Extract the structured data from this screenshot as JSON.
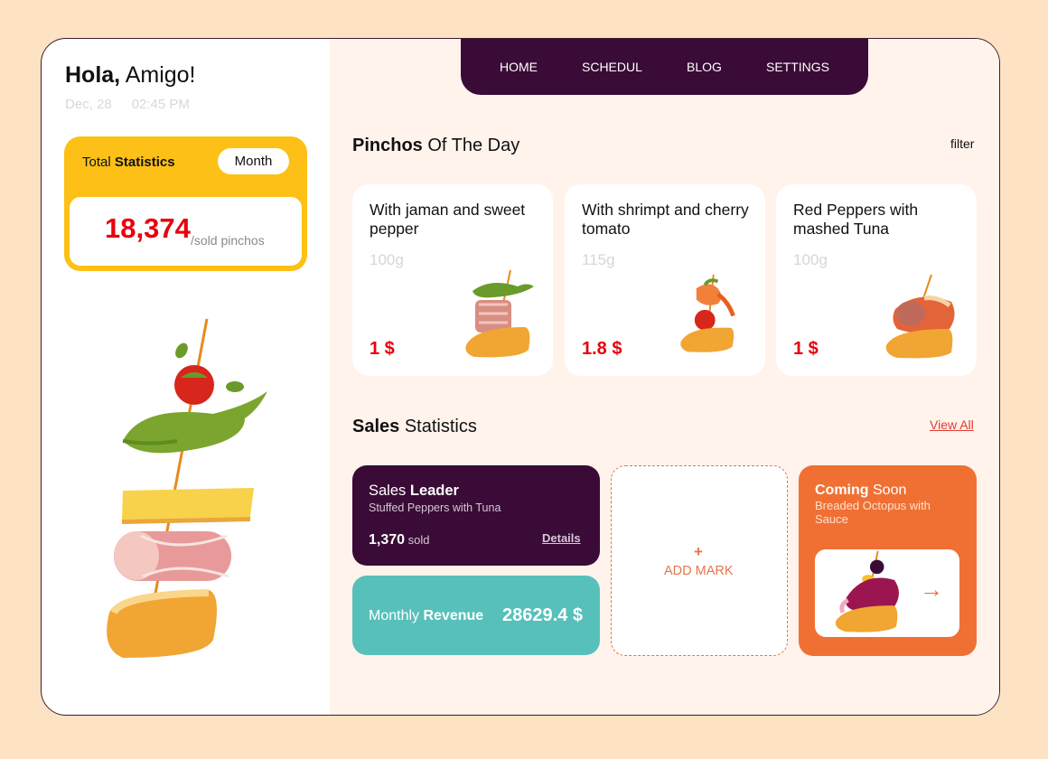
{
  "greeting": {
    "bold": "Hola,",
    "rest": " Amigo!"
  },
  "date": "Dec, 28",
  "time": "02:45 PM",
  "nav": [
    "HOME",
    "SCHEDUL",
    "BLOG",
    "SETTINGS"
  ],
  "total": {
    "label": "Total ",
    "label_bold": "Statistics",
    "period": "Month",
    "value": "18,374",
    "unit": "/sold pinchos"
  },
  "pinchos": {
    "title_bold": "Pinchos",
    "title_rest": " Of The Day",
    "filter": "filter",
    "items": [
      {
        "name": "With jaman and sweet pepper",
        "weight": "100g",
        "price": "1 $"
      },
      {
        "name": "With shrimpt and cherry tomato",
        "weight": "115g",
        "price": "1.8 $"
      },
      {
        "name": "Red Peppers with mashed Tuna",
        "weight": "100g",
        "price": "1 $"
      }
    ]
  },
  "sales": {
    "title_bold": "Sales",
    "title_rest": " Statistics",
    "view_all": "View All",
    "leader": {
      "label": "Sales ",
      "label_bold": "Leader",
      "item": "Stuffed Peppers with Tuna",
      "count": "1,370",
      "count_unit": " sold",
      "details": "Details"
    },
    "revenue": {
      "label": "Monthly ",
      "label_bold": "Revenue",
      "value": "28629.4 $"
    },
    "add_mark": {
      "icon": "plus-icon",
      "label": "ADD MARK"
    },
    "coming": {
      "label_bold": "Coming",
      "label": " Soon",
      "item": "Breaded Octopus with Sauce",
      "icon": "arrow-right-icon"
    }
  },
  "colors": {
    "background": "#fde2c4",
    "accent_dark": "#3a0b37",
    "yellow": "#fdc017",
    "red": "#e8000b",
    "teal": "#58c0ba",
    "orange": "#f07034"
  }
}
